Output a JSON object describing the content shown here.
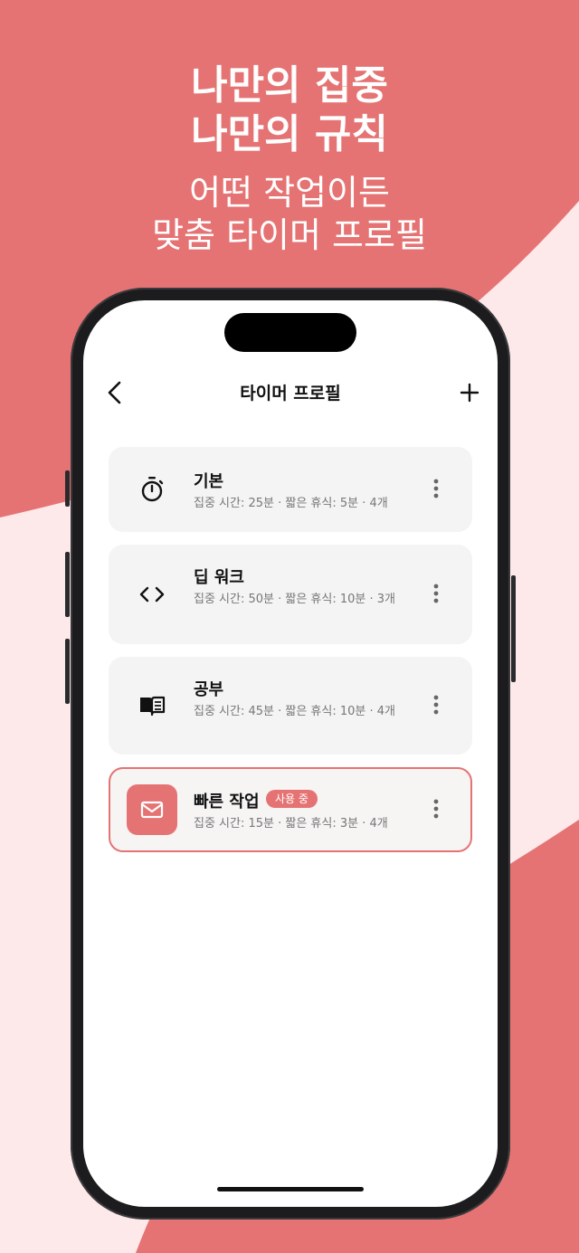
{
  "promo": {
    "headline_line1": "나만의 집중",
    "headline_line2": "나만의 규칙",
    "subline_line1": "어떤 작업이든",
    "subline_line2": "맞춤 타이머 프로필"
  },
  "colors": {
    "accent": "#e57373",
    "background_light": "#fde8ea",
    "card_bg": "#f4f4f4"
  },
  "nav": {
    "title": "타이머 프로필",
    "back_icon": "chevron-left-icon",
    "add_icon": "plus-icon"
  },
  "profiles": [
    {
      "icon": "stopwatch-icon",
      "name": "기본",
      "detail": "집중 시간: 25분 · 짧은 휴식: 5분 · 4개",
      "active": false
    },
    {
      "icon": "code-icon",
      "name": "딥 워크",
      "detail": "집중 시간: 50분 · 짧은 휴식: 10분 · 3개",
      "active": false
    },
    {
      "icon": "book-icon",
      "name": "공부",
      "detail": "집중 시간: 45분 · 짧은 휴식: 10분 · 4개",
      "active": false
    },
    {
      "icon": "mail-icon",
      "name": "빠른 작업",
      "badge": "사용 중",
      "detail": "집중 시간: 15분 · 짧은 휴식: 3분 · 4개",
      "active": true
    }
  ]
}
